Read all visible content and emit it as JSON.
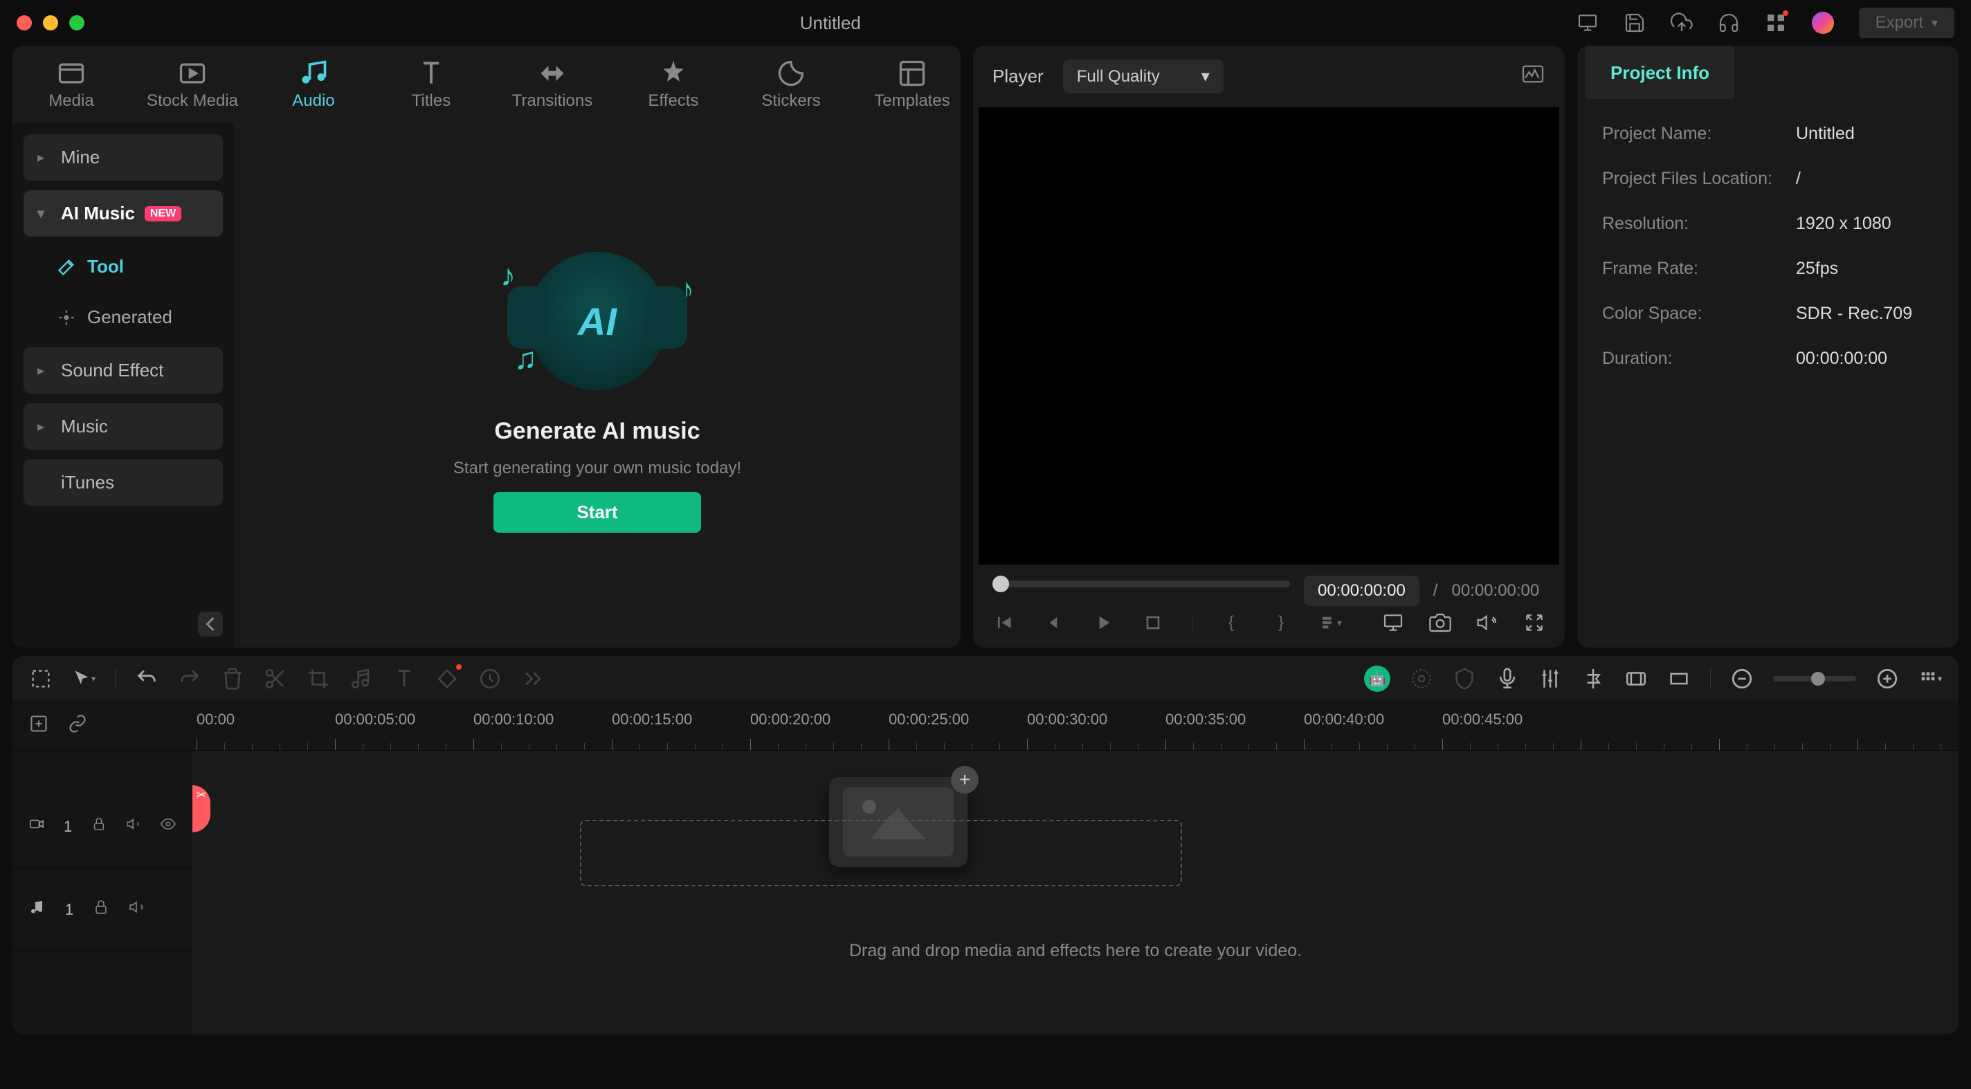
{
  "titlebar": {
    "title": "Untitled",
    "export_label": "Export"
  },
  "media_tabs": [
    {
      "label": "Media"
    },
    {
      "label": "Stock Media"
    },
    {
      "label": "Audio"
    },
    {
      "label": "Titles"
    },
    {
      "label": "Transitions"
    },
    {
      "label": "Effects"
    },
    {
      "label": "Stickers"
    },
    {
      "label": "Templates"
    }
  ],
  "sidebar": {
    "mine": "Mine",
    "ai_music": "AI Music",
    "new_badge": "NEW",
    "tool": "Tool",
    "generated": "Generated",
    "sound_effect": "Sound Effect",
    "music": "Music",
    "itunes": "iTunes"
  },
  "ai_panel": {
    "illus_label": "AI",
    "title": "Generate AI music",
    "subtitle": "Start generating your own music today!",
    "start": "Start"
  },
  "player": {
    "label": "Player",
    "quality": "Full Quality",
    "time_current": "00:00:00:00",
    "time_sep": "/",
    "time_total": "00:00:00:00"
  },
  "info": {
    "tab": "Project Info",
    "rows": [
      {
        "label": "Project Name:",
        "value": "Untitled"
      },
      {
        "label": "Project Files Location:",
        "value": "/"
      },
      {
        "label": "Resolution:",
        "value": "1920 x 1080"
      },
      {
        "label": "Frame Rate:",
        "value": "25fps"
      },
      {
        "label": "Color Space:",
        "value": "SDR - Rec.709"
      },
      {
        "label": "Duration:",
        "value": "00:00:00:00"
      }
    ]
  },
  "ruler": [
    "00:00",
    "00:00:05:00",
    "00:00:10:00",
    "00:00:15:00",
    "00:00:20:00",
    "00:00:25:00",
    "00:00:30:00",
    "00:00:35:00",
    "00:00:40:00",
    "00:00:45:00"
  ],
  "tracks": {
    "video_num": "1",
    "audio_num": "1"
  },
  "drop_hint": "Drag and drop media and effects here to create your video."
}
